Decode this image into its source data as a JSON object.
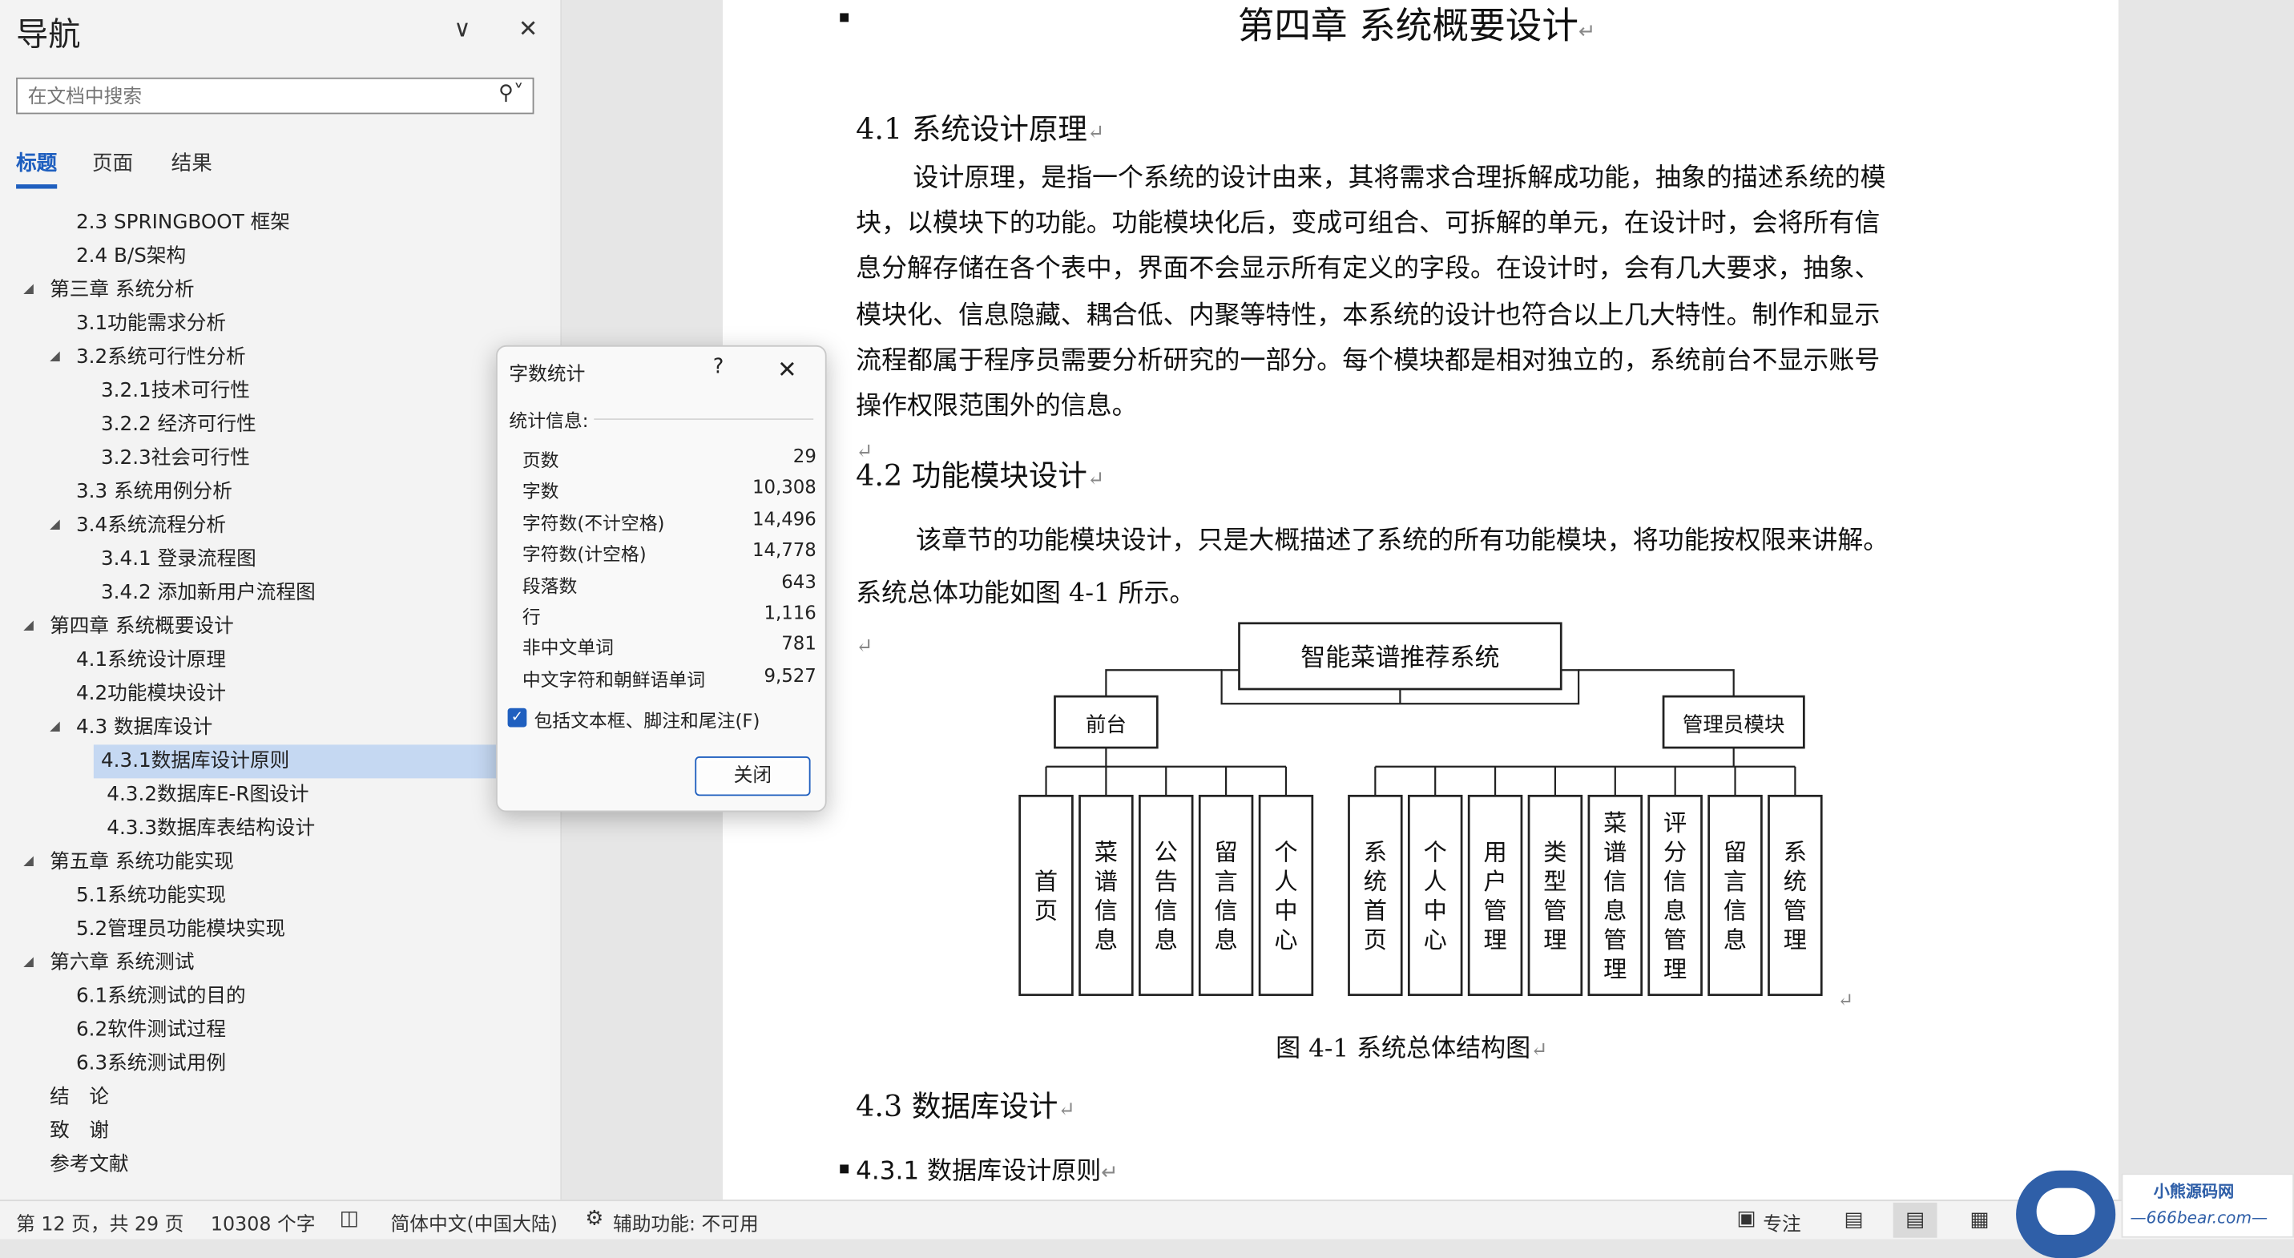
{
  "nav": {
    "title": "导航",
    "search_placeholder": "在文档中搜索",
    "tabs": [
      "标题",
      "页面",
      "结果"
    ],
    "outline": [
      {
        "text": "2.3 SPRINGBOOT 框架",
        "level": 2
      },
      {
        "text": "2.4 B/S架构",
        "level": 2
      },
      {
        "text": "第三章 系统分析",
        "level": 1,
        "expandable": true
      },
      {
        "text": "3.1功能需求分析",
        "level": 2
      },
      {
        "text": "3.2系统可行性分析",
        "level": 2,
        "expandable": true
      },
      {
        "text": "3.2.1技术可行性",
        "level": 3
      },
      {
        "text": "3.2.2 经济可行性",
        "level": 3
      },
      {
        "text": "3.2.3社会可行性",
        "level": 3
      },
      {
        "text": "3.3 系统用例分析",
        "level": 2
      },
      {
        "text": "3.4系统流程分析",
        "level": 2,
        "expandable": true
      },
      {
        "text": "3.4.1 登录流程图",
        "level": 3
      },
      {
        "text": "3.4.2 添加新用户流程图",
        "level": 3
      },
      {
        "text": "第四章 系统概要设计",
        "level": 1,
        "expandable": true
      },
      {
        "text": "4.1系统设计原理",
        "level": 2
      },
      {
        "text": "4.2功能模块设计",
        "level": 2
      },
      {
        "text": "4.3 数据库设计",
        "level": 2,
        "expandable": true
      },
      {
        "text": "4.3.1数据库设计原则",
        "level": 3,
        "selected": true
      },
      {
        "text": "4.3.2数据库E-R图设计",
        "level": 3
      },
      {
        "text": "4.3.3数据库表结构设计",
        "level": 3
      },
      {
        "text": "第五章 系统功能实现",
        "level": 1,
        "expandable": true
      },
      {
        "text": "5.1系统功能实现",
        "level": 2
      },
      {
        "text": "5.2管理员功能模块实现",
        "level": 2
      },
      {
        "text": "第六章 系统测试",
        "level": 1,
        "expandable": true
      },
      {
        "text": "6.1系统测试的目的",
        "level": 2
      },
      {
        "text": "6.2软件测试过程",
        "level": 2
      },
      {
        "text": "6.3系统测试用例",
        "level": 2
      },
      {
        "text": "结　论",
        "level": 1
      },
      {
        "text": "致　谢",
        "level": 1
      },
      {
        "text": "参考文献",
        "level": 1
      }
    ]
  },
  "doc": {
    "chapter_title": "第四章  系统概要设计",
    "s41_title": "4.1 系统设计原理",
    "s41_lines": [
      "设计原理，是指一个系统的设计由来，其将需求合理拆解成功能，抽象的描述系统的模",
      "块，以模块下的功能。功能模块化后，变成可组合、可拆解的单元，在设计时，会将所有信",
      "息分解存储在各个表中，界面不会显示所有定义的字段。在设计时，会有几大要求，抽象、",
      "模块化、信息隐藏、耦合低、内聚等特性，本系统的设计也符合以上几大特性。制作和显示",
      "流程都属于程序员需要分析研究的一部分。每个模块都是相对独立的，系统前台不显示账号",
      "操作权限范围外的信息。"
    ],
    "s42_title": "4.2 功能模块设计",
    "s42_lines": [
      "该章节的功能模块设计，只是大概描述了系统的所有功能模块，将功能按权限来讲解。",
      "系统总体功能如图 4-1 所示。"
    ],
    "diagram": {
      "root": "智能菜谱推荐系统",
      "front": "前台",
      "admin": "管理员模块",
      "front_items": [
        "首页",
        "菜谱信息",
        "公告信息",
        "留言信息",
        "个人中心"
      ],
      "admin_items": [
        "系统首页",
        "个人中心",
        "用户管理",
        "类型管理",
        "菜谱信息管理",
        "评分信息管理",
        "留言信息",
        "系统管理"
      ]
    },
    "figure_caption": "图 4-1  系统总体结构图",
    "s43_title": "4.3  数据库设计",
    "s431_title": "4.3.1 数据库设计原则",
    "return_mark": "↵"
  },
  "dialog": {
    "title": "字数统计",
    "help": "?",
    "section": "统计信息:",
    "stats": [
      {
        "label": "页数",
        "value": "29"
      },
      {
        "label": "字数",
        "value": "10,308"
      },
      {
        "label": "字符数(不计空格)",
        "value": "14,496"
      },
      {
        "label": "字符数(计空格)",
        "value": "14,778"
      },
      {
        "label": "段落数",
        "value": "643"
      },
      {
        "label": "行",
        "value": "1,116"
      },
      {
        "label": "非中文单词",
        "value": "781"
      },
      {
        "label": "中文字符和朝鲜语单词",
        "value": "9,527"
      }
    ],
    "checkbox_label": "包括文本框、脚注和尾注(F)",
    "checkbox_checked": true,
    "close_button": "关闭"
  },
  "status": {
    "page": "第 12 页，共 29 页",
    "words": "10308 个字",
    "language": "简体中文(中国大陆)",
    "accessibility": "辅助功能: 不可用",
    "focus": "专注"
  },
  "watermark": {
    "name": "小熊源码网",
    "url": "—666bear.com—"
  }
}
